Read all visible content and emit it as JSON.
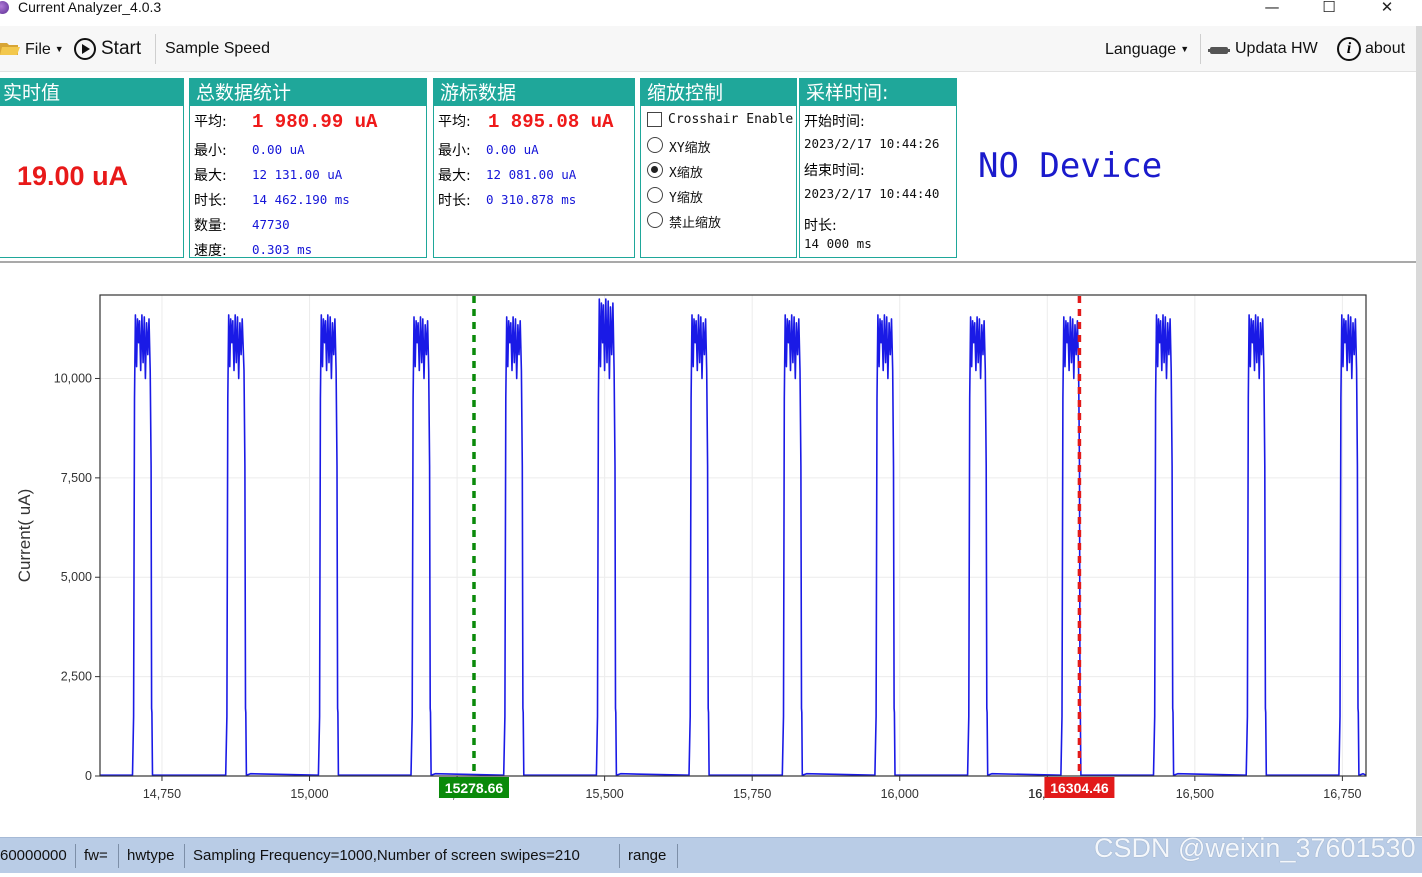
{
  "window": {
    "title": "Current Analyzer_4.0.3",
    "controls": [
      "minimize",
      "maximize",
      "close"
    ]
  },
  "toolbar": {
    "file_label": "File",
    "start_label": "Start",
    "sample_speed_label": "Sample Speed",
    "language_label": "Language",
    "update_hw_label": "Updata HW",
    "about_label": "about"
  },
  "realtime": {
    "title": "实时值",
    "value": "19.00 uA"
  },
  "total_stats": {
    "title": "总数据统计",
    "avg_label": "平均:",
    "avg_value": "1 980.99 uA",
    "min_label": "最小:",
    "min_value": "0.00 uA",
    "max_label": "最大:",
    "max_value": "12 131.00 uA",
    "duration_label": "时长:",
    "duration_value": "14 462.190 ms",
    "count_label": "数量:",
    "count_value": "47730",
    "speed_label": "速度:",
    "speed_value": "0.303 ms"
  },
  "cursor_data": {
    "title": "游标数据",
    "avg_label": "平均:",
    "avg_value": "1 895.08 uA",
    "min_label": "最小:",
    "min_value": "0.00 uA",
    "max_label": "最大:",
    "max_value": "12 081.00 uA",
    "duration_label": "时长:",
    "duration_value": "0 310.878 ms"
  },
  "zoom_control": {
    "title": "缩放控制",
    "crosshair_label": "Crosshair Enable",
    "crosshair_checked": false,
    "options": [
      {
        "label": "XY缩放",
        "selected": false
      },
      {
        "label": "X缩放",
        "selected": true
      },
      {
        "label": "Y缩放",
        "selected": false
      },
      {
        "label": "禁止缩放",
        "selected": false
      }
    ]
  },
  "sample_time": {
    "title": "采样时间:",
    "start_label": "开始时间:",
    "start_value": "2023/2/17 10:44:26",
    "end_label": "结束时间:",
    "end_value": "2023/2/17 10:44:40",
    "duration_label": "时长:",
    "duration_value": "14 000 ms"
  },
  "device_status": "NO Device",
  "chart_data": {
    "type": "line",
    "ylabel": "Current( uA)",
    "xlabel": "",
    "xlim": [
      14645,
      16790
    ],
    "ylim": [
      0,
      12100
    ],
    "x_ticks": [
      "14,750",
      "15,000",
      "15,250",
      "15,500",
      "15,750",
      "16,000",
      "16,250",
      "16,500",
      "16,750"
    ],
    "x_tick_values": [
      14750,
      15000,
      15250,
      15500,
      15750,
      16000,
      16250,
      16500,
      16750
    ],
    "y_ticks": [
      "0",
      "2,500",
      "5,000",
      "7,500",
      "10,000"
    ],
    "y_tick_values": [
      0,
      2500,
      5000,
      7500,
      10000
    ],
    "grid": true,
    "series_color": "#1a1ae6",
    "baseline_value": 19,
    "pulses": [
      {
        "start": 14701,
        "end": 14733,
        "peak": 11600
      },
      {
        "start": 14859,
        "end": 14892,
        "peak": 11600
      },
      {
        "start": 15016,
        "end": 15048,
        "peak": 11600
      },
      {
        "start": 15173,
        "end": 15205,
        "peak": 11550
      },
      {
        "start": 15330,
        "end": 15362,
        "peak": 11550
      },
      {
        "start": 15487,
        "end": 15519,
        "peak": 12000
      },
      {
        "start": 15644,
        "end": 15676,
        "peak": 11600
      },
      {
        "start": 15802,
        "end": 15834,
        "peak": 11600
      },
      {
        "start": 15959,
        "end": 15991,
        "peak": 11600
      },
      {
        "start": 16116,
        "end": 16148,
        "peak": 11550
      },
      {
        "start": 16274,
        "end": 16306,
        "peak": 11550
      },
      {
        "start": 16431,
        "end": 16463,
        "peak": 11600
      },
      {
        "start": 16588,
        "end": 16620,
        "peak": 11600
      },
      {
        "start": 16745,
        "end": 16777,
        "peak": 11600
      }
    ],
    "cursors": [
      {
        "x": 15278.66,
        "label": "15278.66",
        "color": "#0a8a0a"
      },
      {
        "x": 16304.46,
        "label": "16304.46",
        "color": "#e21a1a"
      }
    ],
    "partial_tick_text": "16"
  },
  "statusbar": {
    "items": [
      "60000000",
      "fw=",
      "hwtype",
      "Sampling Frequency=1000,Number of screen swipes=210",
      "range"
    ]
  },
  "watermark": "CSDN @weixin_37601530"
}
